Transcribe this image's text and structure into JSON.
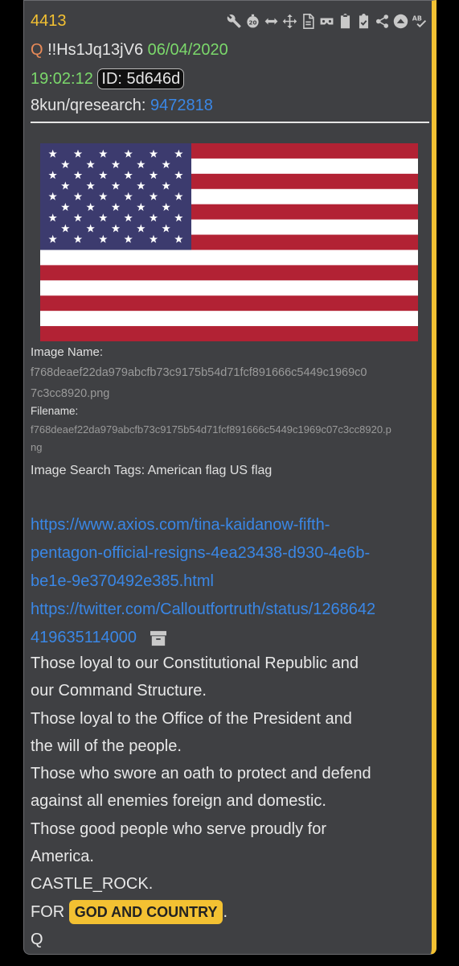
{
  "post": {
    "number": "4413",
    "q_marker": "Q",
    "tripcode": "!!Hs1Jq13jV6",
    "date": "06/04/2020",
    "time": "19:02:12",
    "id_label": "ID: 5d646d",
    "board": "8kun/qresearch:",
    "thread": "9472818"
  },
  "toolbar": {
    "icons": [
      "wrench-icon",
      "timer-20-icon",
      "arrows-horizontal-icon",
      "move-icon",
      "file-icon",
      "vr-headset-icon",
      "clipboard-icon",
      "clipboard-check-icon",
      "share-icon",
      "up-arrow-circle-icon",
      "spellcheck-icon"
    ],
    "timer_label": "20"
  },
  "image": {
    "name_label": "Image Name:",
    "name_value_1": "f768deaef22da979abcfb73c9175b54d71fcf891666c5449c1969c0",
    "name_value_2": "7c3cc8920.png",
    "filename_label": "Filename:",
    "filename_value_1": "f768deaef22da979abcfb73c9175b54d71fcf891666c5449c1969c07c3cc8920.p",
    "filename_value_2": "ng",
    "search_tags": "Image Search Tags: American flag US flag"
  },
  "links": {
    "axios_1": "https://www.axios.com/tina-kaidanow-fifth-",
    "axios_2": "pentagon-official-resigns-4ea23438-d930-4e6b-",
    "axios_3": "be1e-9e370492e385.html",
    "twitter_1": "https://twitter.com/Calloutfortruth/status/1268642",
    "twitter_2": "419635114000"
  },
  "message": {
    "l1": "Those loyal to our Constitutional Republic and",
    "l2": "our Command Structure.",
    "l3": "Those loyal to the Office of the President and",
    "l4": "the will of the people.",
    "l5": "Those who swore an oath to protect and defend",
    "l6": "against all enemies foreign and domestic.",
    "l7": "Those good people who serve proudly for",
    "l8": "America.",
    "l9": "CASTLE_ROCK.",
    "for_text": "FOR",
    "highlight": "GOD AND COUNTRY",
    "period": ".",
    "signature": "Q"
  },
  "colors": {
    "accent": "#f3c132",
    "link": "#3a87e6",
    "date_green": "#7bd86b",
    "q_orange": "#e88a58",
    "card_bg": "#3f4043"
  }
}
